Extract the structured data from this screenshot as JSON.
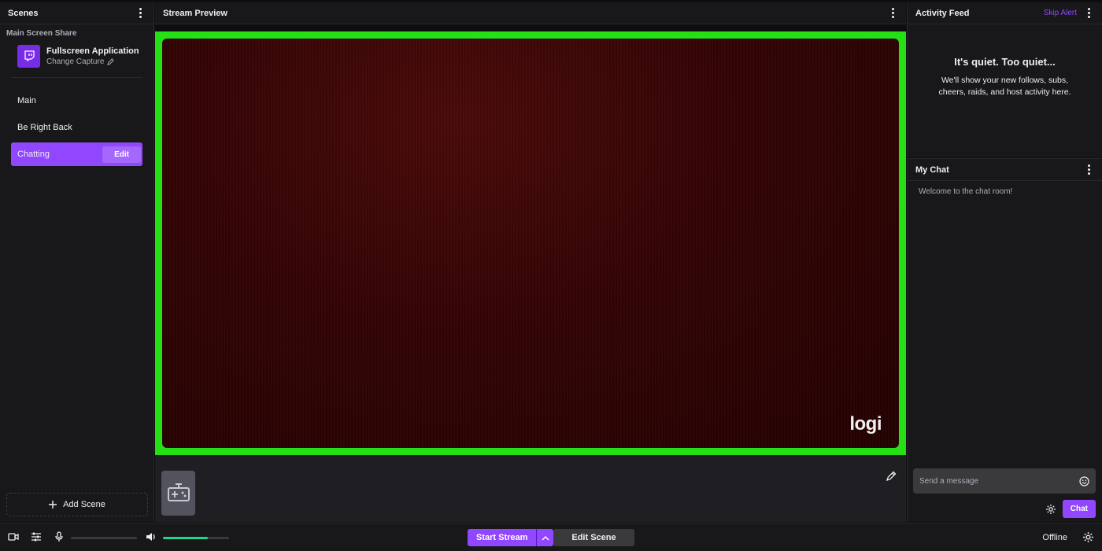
{
  "scenes_panel": {
    "title": "Scenes",
    "section_label": "Main Screen Share",
    "source": {
      "title": "Fullscreen Application",
      "subtitle": "Change Capture"
    },
    "items": [
      {
        "label": "Main"
      },
      {
        "label": "Be Right Back"
      },
      {
        "label": "Chatting",
        "edit_label": "Edit"
      }
    ],
    "add_label": "Add Scene"
  },
  "preview": {
    "title": "Stream Preview",
    "overlay_logo_text": "logi",
    "border_color": "#26e016"
  },
  "activity": {
    "title": "Activity Feed",
    "skip_label": "Skip Alert",
    "empty_title": "It's quiet. Too quiet...",
    "empty_body": "We'll show your new follows, subs, cheers, raids, and host activity here."
  },
  "chat": {
    "title": "My Chat",
    "welcome": "Welcome to the chat room!",
    "placeholder": "Send a message",
    "send_label": "Chat"
  },
  "bottom_bar": {
    "start_label": "Start Stream",
    "edit_scene_label": "Edit Scene",
    "status": "Offline",
    "mic_level": 0,
    "volume_level": 0.68
  },
  "colors": {
    "accent": "#9147ff",
    "background": "#18181b",
    "level": "#19d98a"
  }
}
